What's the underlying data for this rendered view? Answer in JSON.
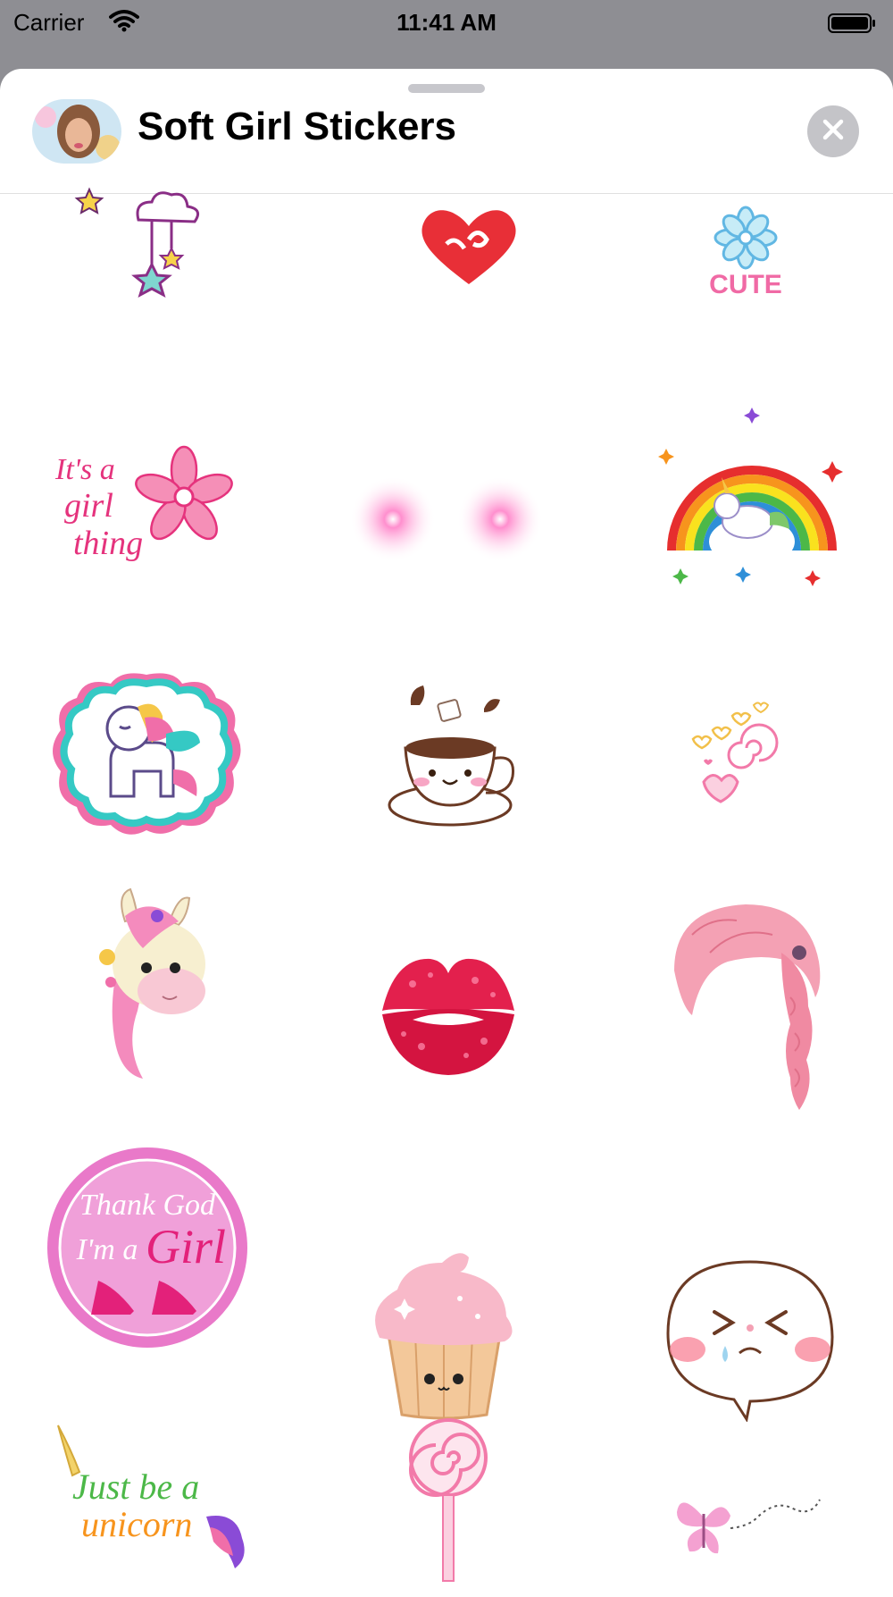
{
  "status_bar": {
    "carrier": "Carrier",
    "time": "11:41 AM"
  },
  "header": {
    "title": "Soft Girl Stickers"
  },
  "stickers": {
    "its_a_girl_thing": "It's a girl thing",
    "cute": "CUTE",
    "thank_god_line1": "Thank God",
    "thank_god_line2": "I'm a",
    "thank_god_line3": "Girl",
    "just_be_a": "Just be a",
    "unicorn": "unicorn"
  },
  "colors": {
    "sheet": "#ffffff",
    "backdrop": "#8e8e93",
    "close_button": "#c4c4c8",
    "pink": "#e8458f",
    "light_pink": "#f6a9cb"
  },
  "icons": {
    "wifi": "wifi-icon",
    "battery": "battery-icon",
    "close": "close-icon"
  }
}
